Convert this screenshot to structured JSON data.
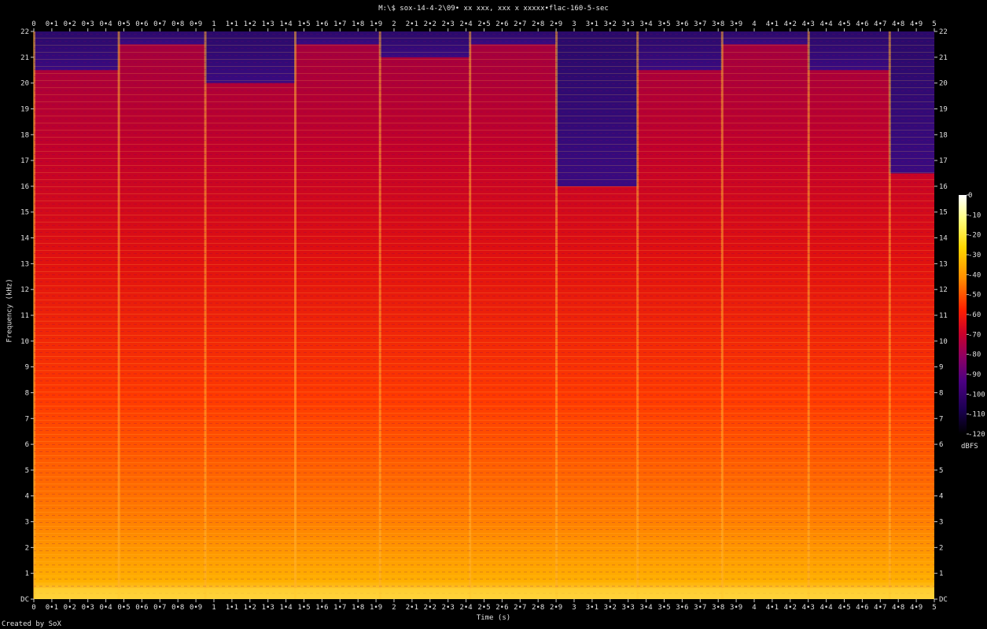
{
  "chart_data": {
    "type": "heatmap",
    "title": "M:\\$ sox-14-4-2\\09• xx xxx, xxx x xxxxx•flac-160-5-sec",
    "xlabel": "Time (s)",
    "ylabel": "Frequency (kHz)",
    "xlim": [
      0,
      5
    ],
    "ylim": [
      0,
      22
    ],
    "x_ticks": [
      "0",
      "0•1",
      "0•2",
      "0•3",
      "0•4",
      "0•5",
      "0•6",
      "0•7",
      "0•8",
      "0•9",
      "1",
      "1•1",
      "1•2",
      "1•3",
      "1•4",
      "1•5",
      "1•6",
      "1•7",
      "1•8",
      "1•9",
      "2",
      "2•1",
      "2•2",
      "2•3",
      "2•4",
      "2•5",
      "2•6",
      "2•7",
      "2•8",
      "2•9",
      "3",
      "3•1",
      "3•2",
      "3•3",
      "3•4",
      "3•5",
      "3•6",
      "3•7",
      "3•8",
      "3•9",
      "4",
      "4•1",
      "4•2",
      "4•3",
      "4•4",
      "4•5",
      "4•6",
      "4•7",
      "4•8",
      "4•9",
      "5"
    ],
    "y_ticks": [
      "DC",
      "1",
      "2",
      "3",
      "4",
      "5",
      "6",
      "7",
      "8",
      "9",
      "10",
      "11",
      "12",
      "13",
      "14",
      "15",
      "16",
      "17",
      "18",
      "19",
      "20",
      "21",
      "22"
    ],
    "colorbar": {
      "label": "dBFS",
      "range": [
        -120,
        0
      ],
      "ticks": [
        "0",
        "-10",
        "-20",
        "-30",
        "-40",
        "-50",
        "-60",
        "-70",
        "-80",
        "-90",
        "-100",
        "-110",
        "-120"
      ],
      "colors": [
        "#ffffff",
        "#ffff80",
        "#ffd700",
        "#ff8c00",
        "#ff2000",
        "#c8002a",
        "#8c0064",
        "#4b0082",
        "#1a0050",
        "#000000"
      ]
    },
    "grid": false,
    "segments": [
      {
        "start": 0.0,
        "end": 0.47,
        "top_khz": 20.5
      },
      {
        "start": 0.47,
        "end": 0.95,
        "top_khz": 21.5
      },
      {
        "start": 0.95,
        "end": 1.45,
        "top_khz": 20.0
      },
      {
        "start": 1.45,
        "end": 1.92,
        "top_khz": 21.5
      },
      {
        "start": 1.92,
        "end": 2.42,
        "top_khz": 21.0
      },
      {
        "start": 2.42,
        "end": 2.9,
        "top_khz": 21.5
      },
      {
        "start": 2.9,
        "end": 3.35,
        "top_khz": 16.0
      },
      {
        "start": 3.35,
        "end": 3.82,
        "top_khz": 20.5
      },
      {
        "start": 3.82,
        "end": 4.3,
        "top_khz": 21.5
      },
      {
        "start": 4.3,
        "end": 4.75,
        "top_khz": 20.5
      },
      {
        "start": 4.75,
        "end": 5.0,
        "top_khz": 16.5
      }
    ]
  },
  "footer": {
    "credit": "Created by SoX"
  }
}
